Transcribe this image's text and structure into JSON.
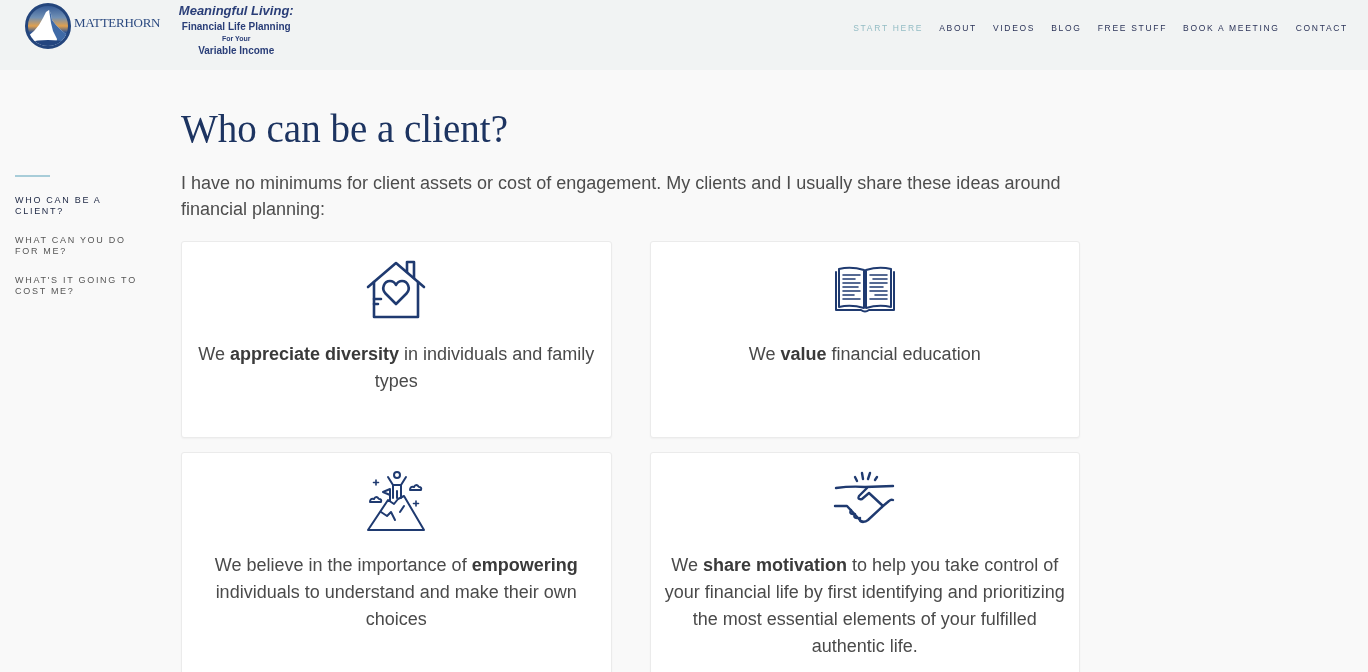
{
  "header": {
    "logo": {
      "name": "MATTERHORN"
    },
    "tagline": [
      "Meaningful Living:",
      "Financial Life Planning",
      "For Your",
      "Variable Income"
    ],
    "nav": [
      {
        "label": "START HERE",
        "selected": true
      },
      {
        "label": "ABOUT",
        "selected": false
      },
      {
        "label": "VIDEOS",
        "selected": false
      },
      {
        "label": "BLOG",
        "selected": false
      },
      {
        "label": "FREE STUFF",
        "selected": false
      },
      {
        "label": "BOOK A MEETING",
        "selected": false
      },
      {
        "label": "CONTACT",
        "selected": false
      }
    ]
  },
  "sidebar": {
    "items": [
      {
        "label": "WHO CAN BE A CLIENT?",
        "selected": true
      },
      {
        "label": "WHAT CAN YOU DO FOR ME?",
        "selected": false
      },
      {
        "label": "WHAT'S IT GOING TO COST ME?",
        "selected": false
      }
    ]
  },
  "main": {
    "title": "Who can be a client?",
    "intro": "I have no minimums for client assets or cost of engagement. My clients and I usually share these ideas around financial planning:",
    "cards": [
      {
        "kind": "house",
        "text": "We **appreciate diversity** in individuals and family types"
      },
      {
        "kind": "book",
        "text": "We **value** financial education"
      },
      {
        "kind": "summit",
        "text": "We believe in the importance of **empowering** individuals to understand and make their own choices"
      },
      {
        "kind": "handshake",
        "text": "We **share motivation** to help you take control of your financial life by first identifying and prioritizing the most essential elements of your fulfilled authentic life."
      }
    ]
  }
}
